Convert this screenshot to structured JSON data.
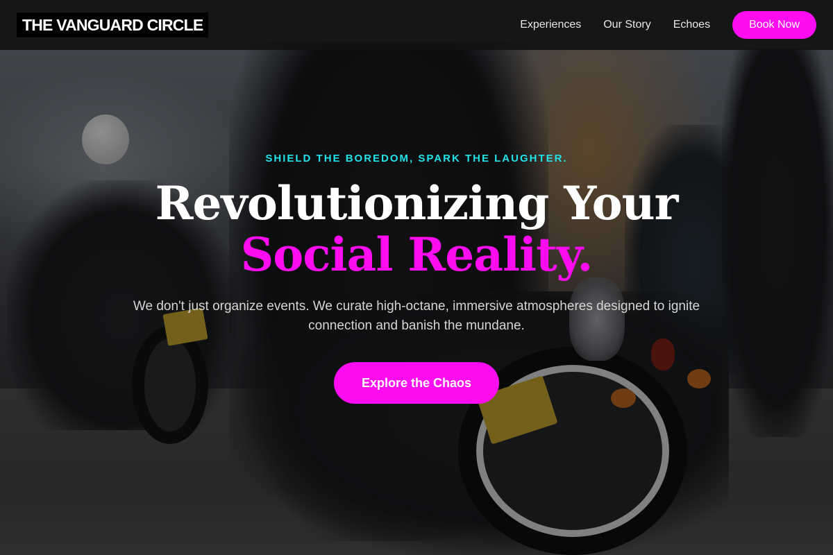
{
  "header": {
    "logo": "THE VANGUARD CIRCLE",
    "nav": [
      {
        "label": "Experiences"
      },
      {
        "label": "Our Story"
      },
      {
        "label": "Echoes"
      }
    ],
    "cta_label": "Book Now"
  },
  "hero": {
    "tagline": "SHIELD THE BOREDOM, SPARK THE LAUGHTER.",
    "headline_line1": "Revolutionizing Your",
    "headline_line2": "Social Reality.",
    "subtext": "We don't just organize events. We curate high-octane, immersive atmospheres designed to ignite connection and banish the mundane.",
    "cta_label": "Explore the Chaos"
  },
  "colors": {
    "accent": "#ff0cf1",
    "tagline": "#22e3ea",
    "header_bg": "#121212"
  }
}
